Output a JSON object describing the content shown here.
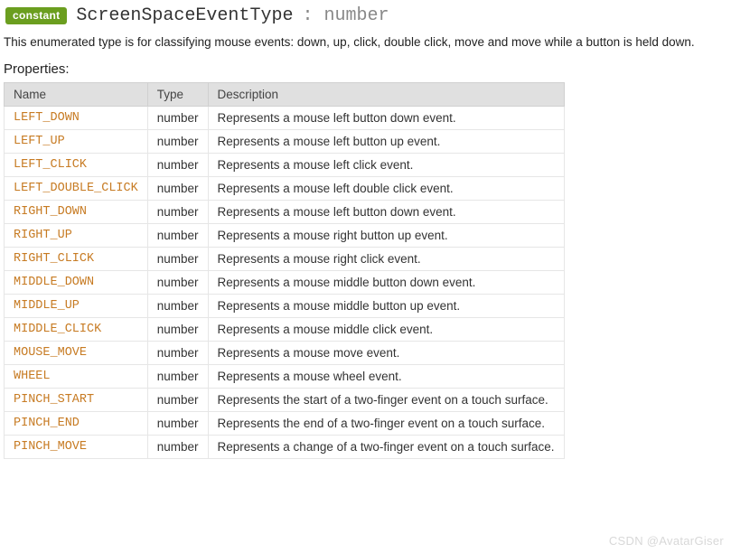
{
  "header": {
    "badge": "constant",
    "name": "ScreenSpaceEventType",
    "signature": ": number"
  },
  "summary": "This enumerated type is for classifying mouse events: down, up, click, double click, move and move while a button is held down.",
  "properties": {
    "heading": "Properties:",
    "columns": [
      "Name",
      "Type",
      "Description"
    ],
    "rows": [
      {
        "name": "LEFT_DOWN",
        "type": "number",
        "desc": "Represents a mouse left button down event."
      },
      {
        "name": "LEFT_UP",
        "type": "number",
        "desc": "Represents a mouse left button up event."
      },
      {
        "name": "LEFT_CLICK",
        "type": "number",
        "desc": "Represents a mouse left click event."
      },
      {
        "name": "LEFT_DOUBLE_CLICK",
        "type": "number",
        "desc": "Represents a mouse left double click event."
      },
      {
        "name": "RIGHT_DOWN",
        "type": "number",
        "desc": "Represents a mouse left button down event."
      },
      {
        "name": "RIGHT_UP",
        "type": "number",
        "desc": "Represents a mouse right button up event."
      },
      {
        "name": "RIGHT_CLICK",
        "type": "number",
        "desc": "Represents a mouse right click event."
      },
      {
        "name": "MIDDLE_DOWN",
        "type": "number",
        "desc": "Represents a mouse middle button down event."
      },
      {
        "name": "MIDDLE_UP",
        "type": "number",
        "desc": "Represents a mouse middle button up event."
      },
      {
        "name": "MIDDLE_CLICK",
        "type": "number",
        "desc": "Represents a mouse middle click event."
      },
      {
        "name": "MOUSE_MOVE",
        "type": "number",
        "desc": "Represents a mouse move event."
      },
      {
        "name": "WHEEL",
        "type": "number",
        "desc": "Represents a mouse wheel event."
      },
      {
        "name": "PINCH_START",
        "type": "number",
        "desc": "Represents the start of a two-finger event on a touch surface."
      },
      {
        "name": "PINCH_END",
        "type": "number",
        "desc": "Represents the end of a two-finger event on a touch surface."
      },
      {
        "name": "PINCH_MOVE",
        "type": "number",
        "desc": "Represents a change of a two-finger event on a touch surface."
      }
    ]
  },
  "watermark": "CSDN @AvatarGiser"
}
